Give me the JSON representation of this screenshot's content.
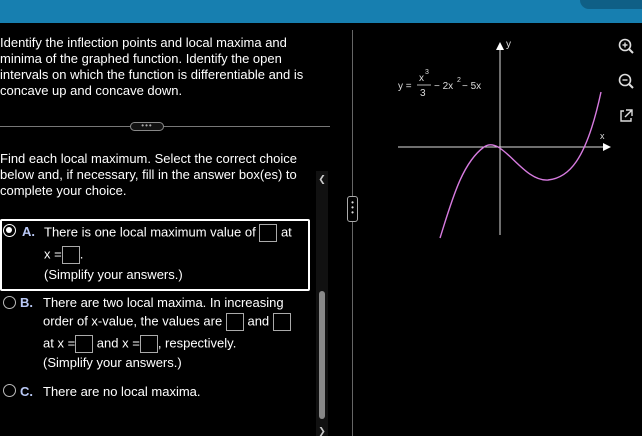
{
  "question": {
    "lines": [
      "Identify the inflection points and local maxima and",
      "minima of the graphed function. Identify the open",
      "intervals on which the function is differentiable and is",
      "concave up and concave down."
    ]
  },
  "instructions": {
    "lines": [
      "Find each local maximum. Select the correct choice",
      "below and, if necessary, fill in the answer box(es) to",
      "complete your choice."
    ]
  },
  "choices": {
    "a": {
      "letter": "A.",
      "text1": "There is one local maximum value of",
      "text1b": "at",
      "text2": "x =",
      "text2b": ".",
      "note": "(Simplify your answers.)"
    },
    "b": {
      "letter": "B.",
      "text1": "There are two local maxima. In increasing",
      "text2": "order of x-value, the values are",
      "and": "and",
      "text3a": "at x =",
      "text3b": "and x =",
      "text3c": ", respectively.",
      "note": "(Simplify your answers.)"
    },
    "c": {
      "letter": "C.",
      "text": "There are no local maxima."
    }
  },
  "drag_handle": "•••",
  "graph": {
    "y_label": "y",
    "x_label": "x",
    "eq_lhs": "y =",
    "eq_num": "x",
    "eq_num_exp": "3",
    "eq_den": "3",
    "eq_mid": "− 2x",
    "eq_mid_exp": "2",
    "eq_tail": "− 5x",
    "curve_color": "#d77be0"
  },
  "tools": [
    "zoom-in-icon",
    "zoom-out-icon",
    "external-link-icon"
  ]
}
